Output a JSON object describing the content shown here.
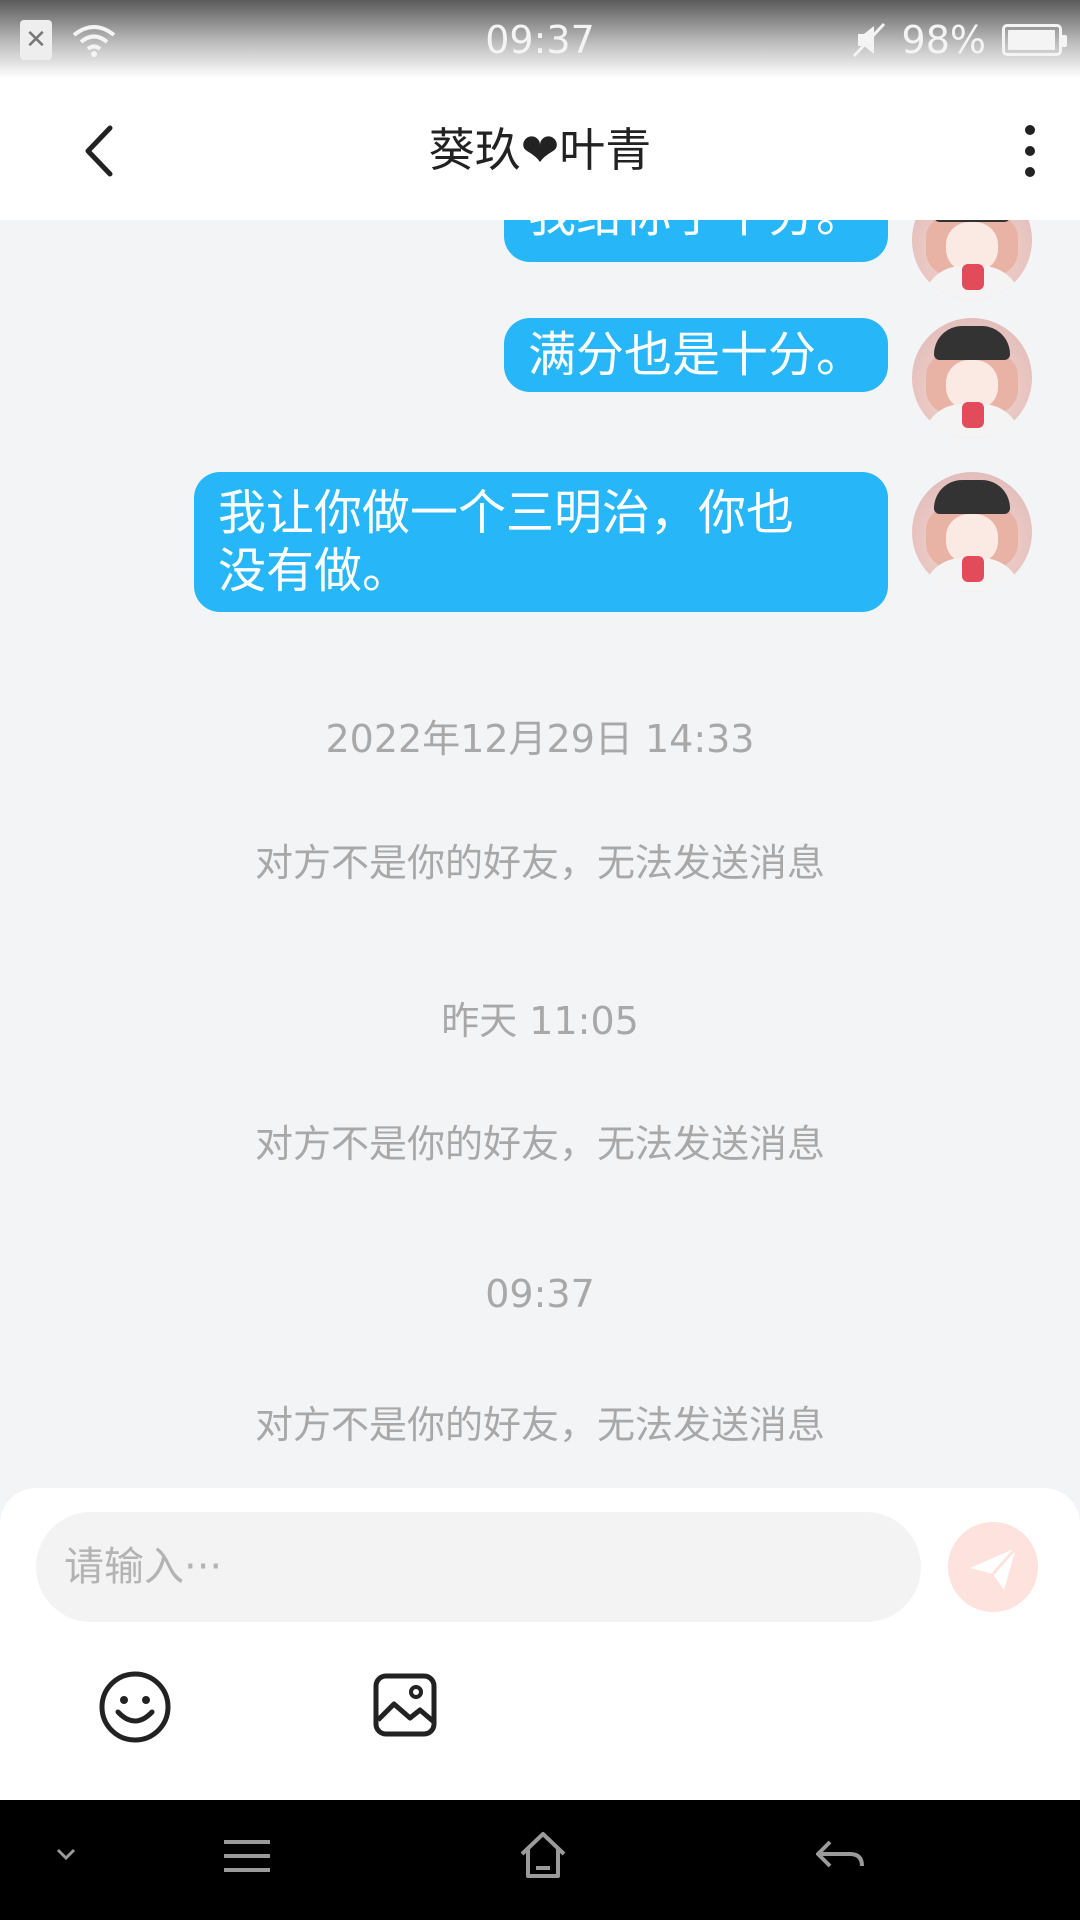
{
  "status_bar": {
    "time": "09:37",
    "battery": "98%",
    "battery_level": 0.98
  },
  "header": {
    "title_part1": "葵玖",
    "title_heart": "❤",
    "title_part2": "叶青"
  },
  "messages": [
    {
      "text": "我给你了十分。"
    },
    {
      "text": "满分也是十分。"
    },
    {
      "text_line1": "我让你做一个三明治，你也",
      "text_line2": "没有做。"
    }
  ],
  "system": [
    {
      "time": "2022年12月29日 14:33",
      "notice": "对方不是你的好友，无法发送消息"
    },
    {
      "time": "昨天 11:05",
      "notice": "对方不是你的好友，无法发送消息"
    },
    {
      "time": "09:37",
      "notice": "对方不是你的好友，无法发送消息"
    }
  ],
  "input": {
    "placeholder": "请输入···"
  },
  "colors": {
    "bubble": "#27b6f7",
    "background": "#f3f4f6",
    "system_text": "#a8a8a8"
  }
}
